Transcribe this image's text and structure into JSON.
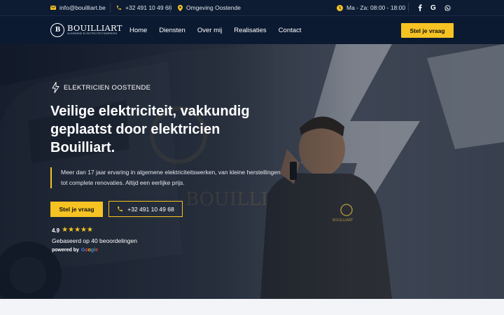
{
  "topbar": {
    "email": "info@bouilliart.be",
    "phone": "+32 491 10 49 68",
    "location": "Omgeving Oostende",
    "hours": "Ma - Za: 08:00 - 18:00",
    "socials": [
      "facebook-icon",
      "google-icon",
      "whatsapp-icon"
    ]
  },
  "nav": {
    "logo_name": "BOUILLIART",
    "logo_sub": "ALGEMENE ELEKTRICITEITSWERKEN",
    "logo_mark": "B",
    "items": [
      {
        "label": "Home"
      },
      {
        "label": "Diensten"
      },
      {
        "label": "Over mij"
      },
      {
        "label": "Realisaties"
      },
      {
        "label": "Contact"
      }
    ],
    "cta": "Stel je vraag"
  },
  "hero": {
    "eyebrow": "ELEKTRICIEN OOSTENDE",
    "headline": "Veilige elektriciteit, vakkundig geplaatst door elektricien Bouilliart.",
    "lead": "Meer dan 17 jaar ervaring in algemene elektriciteitswerken, van kleine herstellingen tot complete renovaties. Altijd een eerlijke prijs.",
    "primary_button": "Stel je vraag",
    "phone_button": "+32 491 10 49 68",
    "rating_value": "4.9",
    "stars": 5,
    "reviews_text": "Gebaseerd op 40 beoordelingen",
    "powered_by": "powered by",
    "google": "Google"
  },
  "colors": {
    "accent": "#f6c323",
    "navy": "#0b1a31",
    "topbar": "#0d1c33"
  }
}
